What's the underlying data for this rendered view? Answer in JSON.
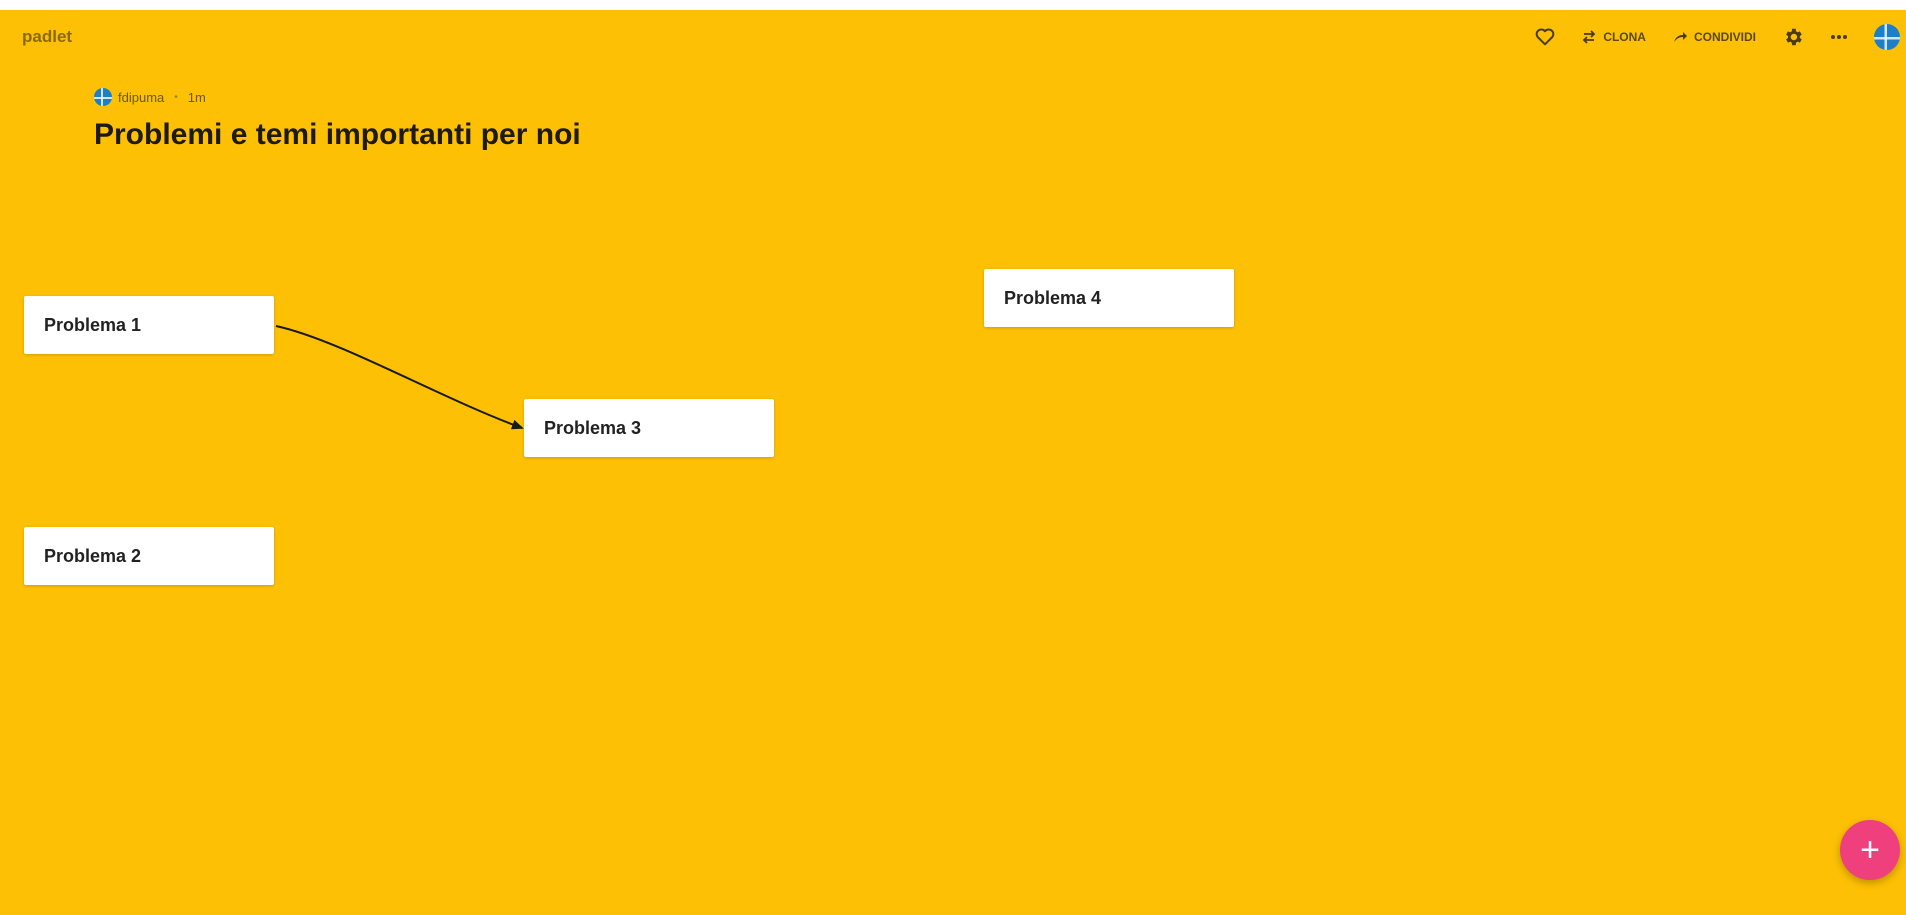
{
  "brand": "padlet",
  "toolbar": {
    "clone_label": "CLONA",
    "share_label": "CONDIVIDI",
    "icons": [
      "heart-icon",
      "clone-icon",
      "share-icon",
      "gear-icon",
      "more-icon",
      "avatar"
    ]
  },
  "header": {
    "author": "fdipuma",
    "time": "1m",
    "title": "Problemi e temi importanti per noi"
  },
  "cards": [
    {
      "label": "Problema 1"
    },
    {
      "label": "Problema 2"
    },
    {
      "label": "Problema 3"
    },
    {
      "label": "Problema 4"
    }
  ],
  "connections": [
    {
      "from": "Problema 1",
      "to": "Problema 3"
    }
  ],
  "fab": {
    "label": "+"
  },
  "colors": {
    "background": "#fdc004",
    "card": "#ffffff",
    "fab": "#ef3f7d",
    "connector": "#1a1a1a"
  }
}
